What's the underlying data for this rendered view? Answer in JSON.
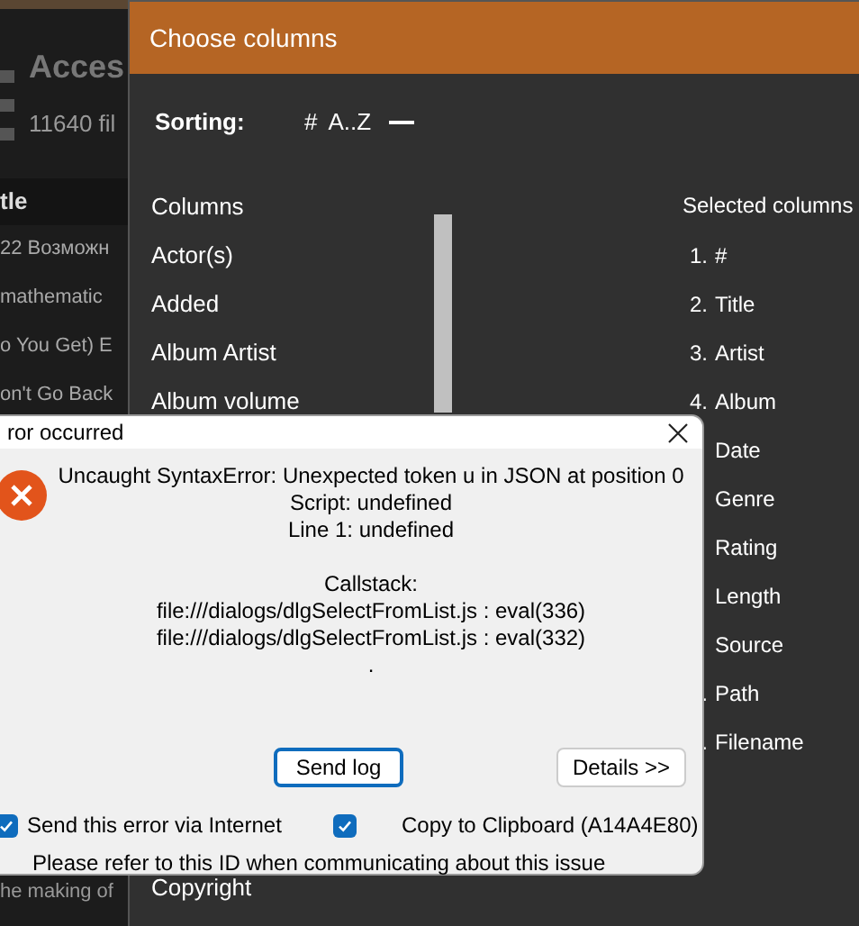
{
  "background_app": {
    "title": "Acces",
    "subtitle": "11640 fil",
    "table_header": "tle",
    "rows": [
      "22 Возможн",
      "mathematic",
      "o You Get) E",
      "on't Go Back"
    ],
    "bottom_row": "he making of"
  },
  "choose_columns": {
    "title": "Choose columns",
    "sorting_label": "Sorting:",
    "sorting_options": [
      "#",
      "A..Z"
    ],
    "columns_heading": "Columns",
    "columns": [
      "Actor(s)",
      "Added",
      "Album Artist",
      "Album volume"
    ],
    "columns_below": [
      "Copyright"
    ],
    "selected_heading": "Selected columns",
    "selected": [
      {
        "number": "1.",
        "name": "#"
      },
      {
        "number": "2.",
        "name": "Title"
      },
      {
        "number": "3.",
        "name": "Artist"
      },
      {
        "number": "4.",
        "name": "Album"
      },
      {
        "name": "Date"
      },
      {
        "name": "Genre"
      },
      {
        "name": "Rating"
      },
      {
        "name": "Length"
      },
      {
        "name": "Source"
      },
      {
        "number": ".",
        "name": "Path"
      },
      {
        "number": ".",
        "name": "Filename"
      }
    ]
  },
  "error_dialog": {
    "title": "ror occurred",
    "message": [
      "Uncaught SyntaxError: Unexpected token u in JSON at position 0",
      "Script: undefined",
      "Line 1: undefined"
    ],
    "callstack_heading": "Callstack:",
    "callstack": [
      "file:///dialogs/dlgSelectFromList.js : eval(336)",
      "file:///dialogs/dlgSelectFromList.js : eval(332)",
      "."
    ],
    "buttons": [
      {
        "label": "Send log",
        "default": true
      },
      {
        "label": "Details >>",
        "default": false
      }
    ],
    "send_via_internet": {
      "label": "Send this error via Internet",
      "checked": true
    },
    "copy_to_clipboard": {
      "label": "Copy to Clipboard (A14A4E80)",
      "checked": true
    },
    "footer": "Please refer to this ID when communicating about this issue"
  }
}
